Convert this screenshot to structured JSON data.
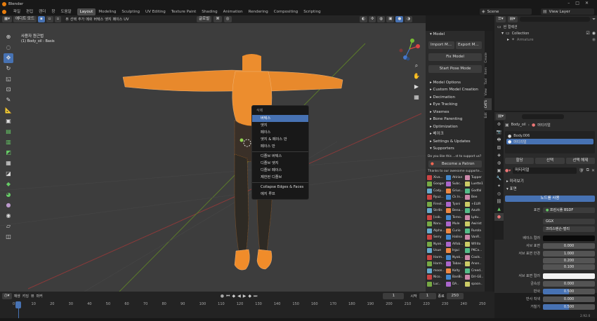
{
  "app": {
    "title": "Blender",
    "logo_color": "#e87d0d"
  },
  "menubar": {
    "items": [
      "파일",
      "편집",
      "렌더",
      "창",
      "도움말"
    ],
    "workspaces": [
      "Layout",
      "Modeling",
      "Sculpting",
      "UV Editing",
      "Texture Paint",
      "Shading",
      "Animation",
      "Rendering",
      "Compositing",
      "Scripting"
    ],
    "active_workspace": "Layout",
    "scene": "Scene",
    "view_layer": "View Layer"
  },
  "viewport_header": {
    "mode": "에디트 모드",
    "transform": "오리엔테이션:",
    "orientation": "기본 값",
    "drag": "드래그:",
    "select": "Select Box",
    "menus": [
      "뷰",
      "선택",
      "추가",
      "메쉬",
      "버텍스",
      "엣지",
      "페이스",
      "UV"
    ],
    "pivot": "글로벌",
    "options": "옵션"
  },
  "viewport": {
    "view_name": "사용자 원근법",
    "object_info": "(1) Body_oil : Basis"
  },
  "toolbar": {
    "tools": [
      "cursor-icon",
      "select-icon",
      "move-icon",
      "rotate-icon",
      "scale-icon",
      "transform-icon",
      "annotate-icon",
      "measure-icon",
      "add-cube-icon",
      "extrude-icon",
      "inset-icon",
      "bevel-icon",
      "loopcut-icon",
      "knife-icon",
      "polybuild-icon",
      "spin-icon",
      "smooth-icon",
      "shrink-icon",
      "shear-icon",
      "rip-icon"
    ]
  },
  "context_menu": {
    "title": "삭제",
    "items": [
      "버텍스",
      "엣지",
      "페이스",
      "엣지 & 페이스 만",
      "페이스 만",
      "디졸브 버텍스",
      "디졸브 엣지",
      "디졸브 페이스",
      "제한된 디졸브",
      "Collapse Edges & Faces",
      "에지 루프"
    ],
    "highlighted": 0
  },
  "npanel": {
    "model_header": "Model",
    "import_label": "Import M...",
    "export_label": "Export M...",
    "fix_model": "Fix Model",
    "start_pose": "Start Pose Mode",
    "sections": [
      "Model Options",
      "Custom Model Creation",
      "Decimation",
      "Eye Tracking",
      "Visemes",
      "Bone Parenting",
      "Optimization",
      "베이크",
      "Settings & Updates"
    ],
    "supporters_header": "Supporters",
    "support_question": "Do you like this ...st to support us?",
    "become_patron": "Become a Patron",
    "thanks_text": "Thanks to our awesome supporte...",
    "patrons": [
      [
        "Xiva...",
        "Atirian",
        "Tupper"
      ],
      [
        "Googer",
        "Subc...",
        "Luette1"
      ],
      [
        "Cody...",
        "Grius...",
        "Godfal"
      ],
      [
        "Ryuz...",
        "Ck ln...",
        "Bee"
      ],
      [
        "Firest...",
        "Tyoni",
        "+ELIR"
      ],
      [
        "Str4ls",
        "Bena...",
        "Azuth"
      ],
      [
        "[cob..",
        "Torno..",
        "Lydu.."
      ],
      [
        "Naru..",
        "Mule",
        "Awirist"
      ],
      [
        "Alpha...",
        "Curio",
        "Rurola"
      ],
      [
        "Serry",
        "Halina",
        "VanR.."
      ],
      [
        "Nyak...",
        "Alfob...",
        "Wfrito"
      ],
      [
        "Usue",
        "Irgui",
        "PKCa..."
      ],
      [
        "Harm..",
        "Nyak...",
        "Cools.."
      ],
      [
        "Harm..",
        "Tabas...",
        "Anon.."
      ],
      [
        "moon..",
        "Kolty",
        "Creed.."
      ],
      [
        "Nico..",
        "BanBi..",
        "Drl-GE.."
      ],
      [
        "Luc..",
        "DA..",
        "space.."
      ]
    ],
    "side_tabs": [
      "Create",
      "Item",
      "Tool",
      "View",
      "CATS",
      "Edit"
    ]
  },
  "outliner": {
    "root": "씬 컬렉션",
    "collection": "Collection",
    "child": "Armature"
  },
  "properties": {
    "object": "Body_oil",
    "material_tab": "머티리얼",
    "slots": [
      "Body.006",
      "머티리얼"
    ],
    "material_name": "머티리얼",
    "buttons": [
      "할당",
      "선택",
      "선택 해제"
    ],
    "sections": [
      "미리보기",
      "표면"
    ],
    "use_nodes": "노드를 사용",
    "surface_label": "표면",
    "surface_value": "프린시플 BSDF",
    "distribution": "GGX",
    "subsurface_method": "크리스텐슨-벌리",
    "rows": [
      [
        "베이스 컬러",
        ""
      ],
      [
        "서브 표면",
        "0.000"
      ],
      [
        "서브 표면 반경",
        "1.000"
      ],
      [
        "",
        "0.200"
      ],
      [
        "",
        "0.100"
      ],
      [
        "서브 표면 컬러",
        ""
      ],
      [
        "금속성",
        "0.000"
      ],
      [
        "반사",
        "0.500"
      ],
      [
        "반사 착색",
        "0.000"
      ],
      [
        "거칠기",
        "0.500"
      ]
    ]
  },
  "timeline": {
    "menus": [
      "재생",
      "키잉",
      "뷰",
      "마커"
    ],
    "current_frame": "1",
    "start_label": "시작",
    "start": "1",
    "end_label": "종료",
    "end": "250",
    "ticks": [
      "0",
      "10",
      "20",
      "30",
      "40",
      "50",
      "60",
      "70",
      "80",
      "90",
      "100",
      "110",
      "120",
      "130",
      "140",
      "150",
      "160",
      "170",
      "180",
      "190",
      "200",
      "210",
      "220",
      "230",
      "240",
      "250"
    ]
  },
  "statusbar": {
    "version": "2.92.0"
  }
}
